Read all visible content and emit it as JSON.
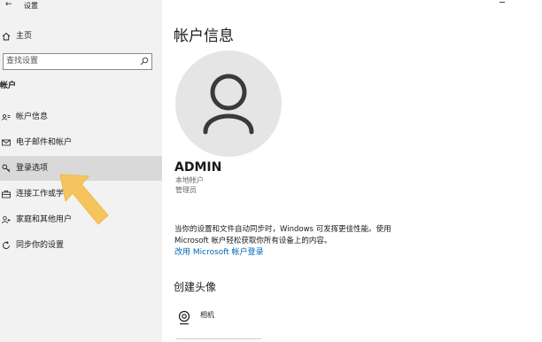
{
  "window": {
    "title": "设置"
  },
  "sidebar": {
    "home_label": "主页",
    "search_placeholder": "查找设置",
    "section_title": "帐户",
    "items": [
      {
        "label": "帐户信息",
        "icon": "person-card-icon"
      },
      {
        "label": "电子邮件和帐户",
        "icon": "mail-icon"
      },
      {
        "label": "登录选项",
        "icon": "key-icon",
        "selected": true
      },
      {
        "label": "连接工作或学",
        "icon": "briefcase-icon"
      },
      {
        "label": "家庭和其他用户",
        "icon": "add-person-icon"
      },
      {
        "label": "同步你的设置",
        "icon": "sync-icon"
      }
    ]
  },
  "main": {
    "title": "帐户信息",
    "username": "ADMIN",
    "account_type": "本地帐户",
    "account_role": "管理员",
    "sync_notice": "当你的设置和文件自动同步时，Windows 可发挥更佳性能。使用 Microsoft 帐户轻松获取你所有设备上的内容。",
    "ms_link": "改用 Microsoft 帐户登录",
    "avatar_heading": "创建头像",
    "camera_label": "相机"
  },
  "colors": {
    "sidebar_bg": "#f2f2f2",
    "selected_bg": "#d9d9d9",
    "link": "#0067b8",
    "annotation_arrow": "#f6c45f"
  }
}
